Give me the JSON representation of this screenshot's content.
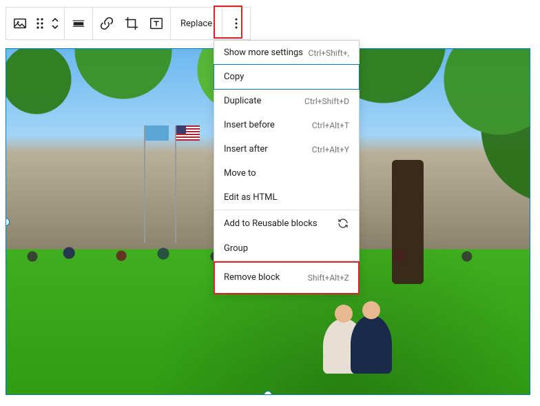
{
  "toolbar": {
    "replace_label": "Replace"
  },
  "menu": {
    "show_more": {
      "label": "Show more settings",
      "shortcut": "Ctrl+Shift+,"
    },
    "copy": {
      "label": "Copy"
    },
    "duplicate": {
      "label": "Duplicate",
      "shortcut": "Ctrl+Shift+D"
    },
    "insert_before": {
      "label": "Insert before",
      "shortcut": "Ctrl+Alt+T"
    },
    "insert_after": {
      "label": "Insert after",
      "shortcut": "Ctrl+Alt+Y"
    },
    "move_to": {
      "label": "Move to"
    },
    "edit_html": {
      "label": "Edit as HTML"
    },
    "reusable": {
      "label": "Add to Reusable blocks"
    },
    "group": {
      "label": "Group"
    },
    "remove": {
      "label": "Remove block",
      "shortcut": "Shift+Alt+Z"
    }
  }
}
